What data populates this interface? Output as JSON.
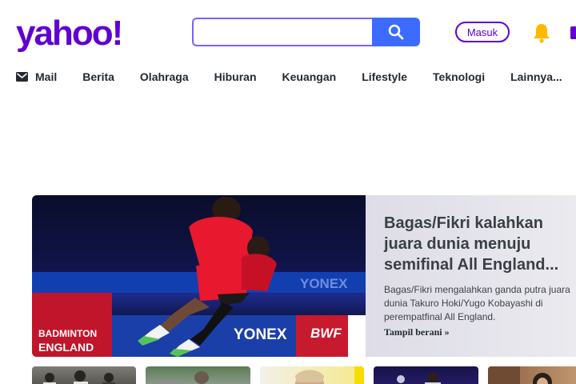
{
  "header": {
    "logo_text": "yahoo!",
    "search": {
      "value": "",
      "placeholder": "",
      "button_icon": "search-icon"
    },
    "signin_label": "Masuk",
    "bell_icon": "bell-icon",
    "brand_color": "#6001d2",
    "accent_color": "#3b6bff"
  },
  "nav": {
    "mail_label": "Mail",
    "items": [
      {
        "label": "Berita"
      },
      {
        "label": "Olahraga"
      },
      {
        "label": "Hiburan"
      },
      {
        "label": "Keuangan"
      },
      {
        "label": "Lifestyle"
      },
      {
        "label": "Teknologi"
      },
      {
        "label": "Lainnya..."
      }
    ]
  },
  "hero": {
    "title": "Bagas/Fikri kalahkan juara dunia menuju semifinal All England...",
    "summary": "Bagas/Fikri mengalahkan ganda putra juara dunia Takuro Hoki/Yugo Kobayashi di perempatfinal All England.",
    "more_label": "Tampil berani »",
    "image": {
      "board_left_top": "BADMINTON",
      "board_left_bottom": "ENGLAND",
      "board_center": "YONEX",
      "board_right": "BWF",
      "board_back": "YONEX"
    }
  }
}
